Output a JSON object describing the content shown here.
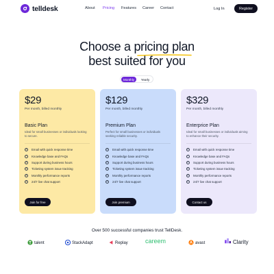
{
  "header": {
    "logo_text": "telldesk",
    "nav": [
      {
        "label": "About",
        "active": false
      },
      {
        "label": "Pricing",
        "active": true
      },
      {
        "label": "Features",
        "active": false
      },
      {
        "label": "Career",
        "active": false
      },
      {
        "label": "Contact",
        "active": false
      }
    ],
    "login_label": "Log In",
    "register_label": "Register"
  },
  "hero": {
    "title_line1_pre": "Choose a ",
    "title_line1_highlight": "pricing plan",
    "title_line2": "best suited for you"
  },
  "billing_toggle": {
    "monthly_label": "Monthly",
    "yearly_label": "Yearly",
    "selected": "Monthly"
  },
  "plans": [
    {
      "price": "$29",
      "period": "Per month, billed monthly",
      "name": "Basic Plan",
      "description": "Ideal for small businesses or individuals looking to secure.",
      "features": [
        "Email with quick response time",
        "Knowledge base and FAQs",
        "Support during business hours",
        "Ticketing system issue tracking",
        "Monthly performance reports",
        "24/7 live chat support"
      ],
      "cta": "Join for free"
    },
    {
      "price": "$129",
      "period": "Per month, billed monthly",
      "name": "Premium Plan",
      "description": "Perfect for small businesses or individuals seeking reliable security.",
      "features": [
        "Email with quick response time",
        "Knowledge base and FAQs",
        "Support during business hours",
        "Ticketing system issue tracking",
        "Monthly performance reports",
        "24/7 live chat support"
      ],
      "cta": "Join premium"
    },
    {
      "price": "$329",
      "period": "Per month, billed monthly",
      "name": "Enterprice Plan",
      "description": "Ideal for small businesses or individuals aiming to enhance their security.",
      "features": [
        "Email with quick response time",
        "Knowledge base and FAQs",
        "Support during business hours",
        "Ticketing system issue tracking",
        "Monthly performance reports",
        "24/7 live chat support"
      ],
      "cta": "Contact us"
    }
  ],
  "trust": {
    "title": "Over 500 successful companies trust TellDesk.",
    "brands": [
      {
        "name": "talent",
        "icon": "talent-logo-icon"
      },
      {
        "name": "StackAdapt",
        "icon": "stackadapt-logo-icon"
      },
      {
        "name": "Replay",
        "icon": "replay-logo-icon"
      },
      {
        "name": "careem",
        "icon": "careem-logo-icon"
      },
      {
        "name": "avast",
        "icon": "avast-logo-icon"
      },
      {
        "name": "Clarity",
        "icon": "clarity-logo-icon"
      }
    ]
  },
  "colors": {
    "brand_purple": "#6d28d9",
    "accent_yellow": "#f5c518",
    "card_basic": "#fde9a5",
    "card_premium": "#c9dcfb",
    "card_enterprise": "#ece8fb",
    "dark_button": "#0f0f1f"
  }
}
